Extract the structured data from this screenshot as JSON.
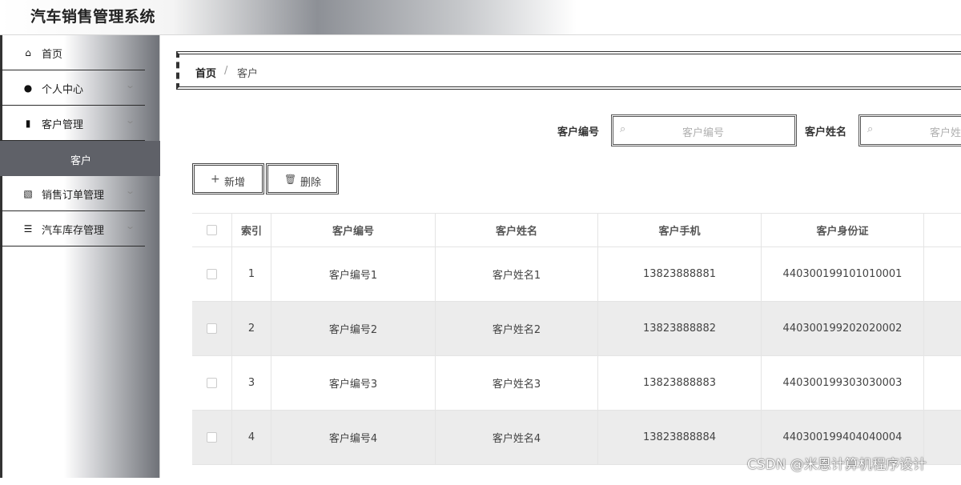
{
  "app": {
    "title": "汽车销售管理系统"
  },
  "sidebar": {
    "items": [
      {
        "label": "首页",
        "icon": "home-icon",
        "glyph": "⌂",
        "expandable": false
      },
      {
        "label": "个人中心",
        "icon": "user-icon",
        "glyph": "●",
        "expandable": true
      },
      {
        "label": "客户管理",
        "icon": "ticket-icon",
        "glyph": "▮",
        "expandable": true
      },
      {
        "label": "销售订单管理",
        "icon": "chart-icon",
        "glyph": "▧",
        "expandable": true
      },
      {
        "label": "汽车库存管理",
        "icon": "sliders-icon",
        "glyph": "☰",
        "expandable": true
      }
    ],
    "active_sub": "客户",
    "chevron": "⌄"
  },
  "breadcrumb": {
    "home": "首页",
    "separator": "/",
    "current": "客户"
  },
  "search": {
    "fields": [
      {
        "label": "客户编号",
        "placeholder": "客户编号"
      },
      {
        "label": "客户姓名",
        "placeholder": "客户姓"
      }
    ],
    "search_glyph": "⌕"
  },
  "toolbar": {
    "add": {
      "label": "新增",
      "glyph": "+"
    },
    "delete": {
      "label": "删除",
      "glyph": "🗑"
    }
  },
  "table": {
    "columns": [
      "",
      "索引",
      "客户编号",
      "客户姓名",
      "客户手机",
      "客户身份证",
      ""
    ],
    "rows": [
      {
        "index": "1",
        "code": "客户编号1",
        "name": "客户姓名1",
        "phone": "13823888881",
        "id_card": "440300199101010001"
      },
      {
        "index": "2",
        "code": "客户编号2",
        "name": "客户姓名2",
        "phone": "13823888882",
        "id_card": "440300199202020002"
      },
      {
        "index": "3",
        "code": "客户编号3",
        "name": "客户姓名3",
        "phone": "13823888883",
        "id_card": "440300199303030003"
      },
      {
        "index": "4",
        "code": "客户编号4",
        "name": "客户姓名4",
        "phone": "13823888884",
        "id_card": "440300199404040004"
      }
    ]
  },
  "watermark": "CSDN @米恩计算机程序设计",
  "colors": {
    "active_bg": "#5f6168",
    "stripe": "#ececec",
    "border": "#e4e4e4"
  }
}
